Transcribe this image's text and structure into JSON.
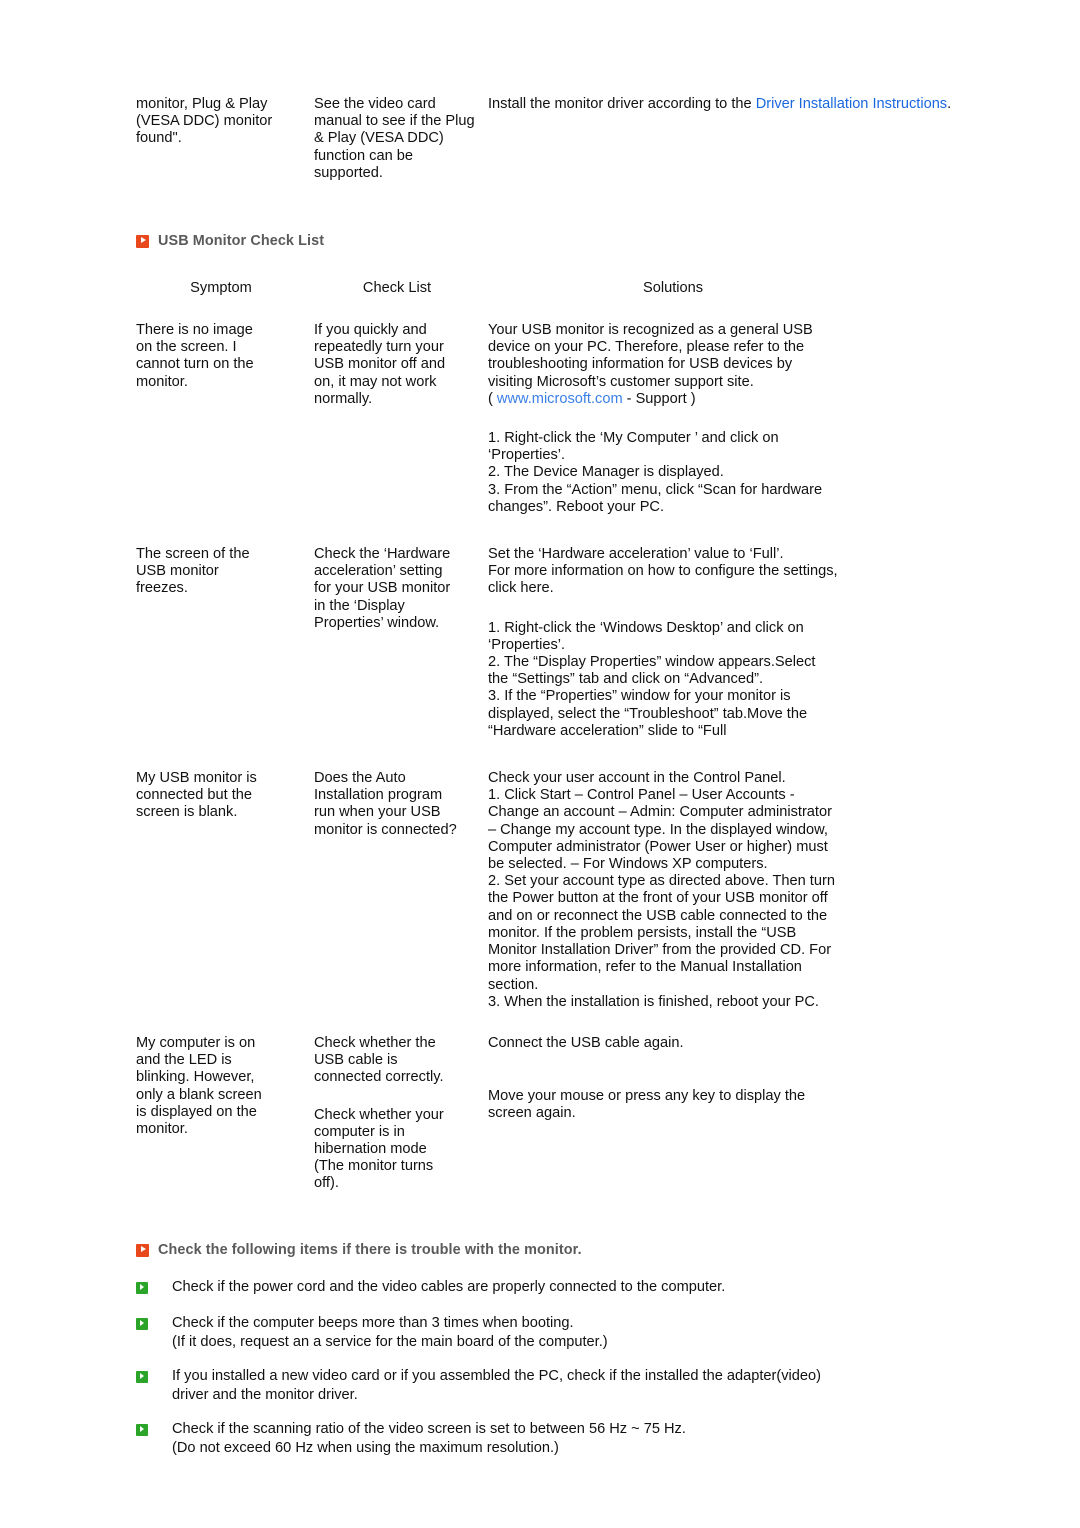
{
  "continued_table": {
    "symptom": "monitor, Plug & Play\n(VESA DDC) monitor\nfound\".",
    "check_list": "See the video card\nmanual to see if the Plug\n& Play (VESA DDC)\nfunction can be\nsupported.",
    "solution_pre": "Install the monitor driver according to the ",
    "solution_link": "Driver Installation Instructions",
    "solution_post": "."
  },
  "usb_section": {
    "icon": "orange-play-square-icon",
    "title": "USB Monitor Check List",
    "headers": {
      "symptom": "Symptom",
      "check_list": "Check List",
      "solutions": "Solutions"
    },
    "rows": [
      {
        "symptom": "There is no image\non the screen. I\ncannot turn on the\nmonitor.",
        "check_list": "If you quickly and\nrepeatedly turn your\nUSB monitor off and\non, it may not work\nnormally.",
        "solution_part1": "Your USB monitor is recognized as a general USB\ndevice on your PC. Therefore, please refer to the\ntroubleshooting information for USB devices by\nvisiting Microsoft’s customer support site.\n( ",
        "solution_link": "www.microsoft.com",
        "solution_part2": " - Support )",
        "solution_steps": "1. Right-click the ‘My Computer ’ and click on\n‘Properties’.\n2. The Device Manager is displayed.\n3. From the “Action” menu, click “Scan for hardware\nchanges”. Reboot your PC."
      },
      {
        "symptom": "The screen of the\nUSB monitor\nfreezes.",
        "check_list": "Check the ‘Hardware\nacceleration’ setting\nfor your USB monitor\nin the ‘Display\nProperties’ window.",
        "solution_part1": "Set the ‘Hardware acceleration’ value to ‘Full’.\nFor more information on how to configure the settings,\nclick here.",
        "solution_steps": "1. Right-click the ‘Windows Desktop’ and click on\n‘Properties’.\n2. The “Display Properties” window appears.Select\nthe “Settings” tab and click on “Advanced”.\n3. If the “Properties” window for your monitor is\ndisplayed, select the “Troubleshoot” tab.Move the\n“Hardware acceleration” slide to “Full"
      },
      {
        "symptom": "My USB monitor is\nconnected but the\nscreen is blank.",
        "check_list": "Does the Auto\nInstallation program\nrun when your USB\nmonitor is connected?",
        "solution_part1": "Check your user account in the Control Panel.\n1. Click Start – Control Panel – User Accounts -\nChange an account – Admin: Computer administrator\n– Change my account type. In the displayed window,\nComputer administrator (Power User or higher) must\nbe selected. – For Windows XP computers.\n2. Set your account type as directed above. Then turn\nthe Power button at the front of your USB monitor off\nand on or reconnect the USB cable connected to the\nmonitor. If the problem persists, install the “USB\nMonitor Installation Driver” from the provided CD. For\nmore information, refer to the Manual Installation\nsection.\n3. When the installation is finished, reboot your PC."
      },
      {
        "symptom": "My computer is on\nand the LED is\nblinking. However,\nonly a blank screen\nis displayed on the\nmonitor.",
        "check_list": "Check whether the\nUSB cable is\nconnected correctly.",
        "solution_part1": "Connect the USB cable again.",
        "check_list_2": "Check whether your\ncomputer is in\nhibernation mode\n(The monitor turns\noff).",
        "solution_part2": "Move your mouse or press any key to display the\nscreen again."
      }
    ]
  },
  "bottom_section": {
    "icon": "orange-play-square-icon",
    "title": "Check the following items if there is trouble with the monitor.",
    "bullet_icon": "green-play-square-icon",
    "items": [
      "Check if the power cord and the video cables are properly connected to the computer.",
      "Check if the computer beeps more than 3 times when booting.\n(If it does, request an a service for the main board of the computer.)",
      "If you installed a new video card or if you assembled the PC, check if the installed the adapter(video)\ndriver and the monitor driver.",
      "Check if the scanning ratio of the video screen is set to between 56 Hz ~ 75 Hz.\n(Do not exceed 60 Hz when using the maximum resolution.)"
    ]
  },
  "colors": {
    "accent_orange": "#e8481c",
    "accent_green": "#2aa52a",
    "link_blue": "#1a68e0",
    "heading_gray": "#5a5a5a"
  }
}
